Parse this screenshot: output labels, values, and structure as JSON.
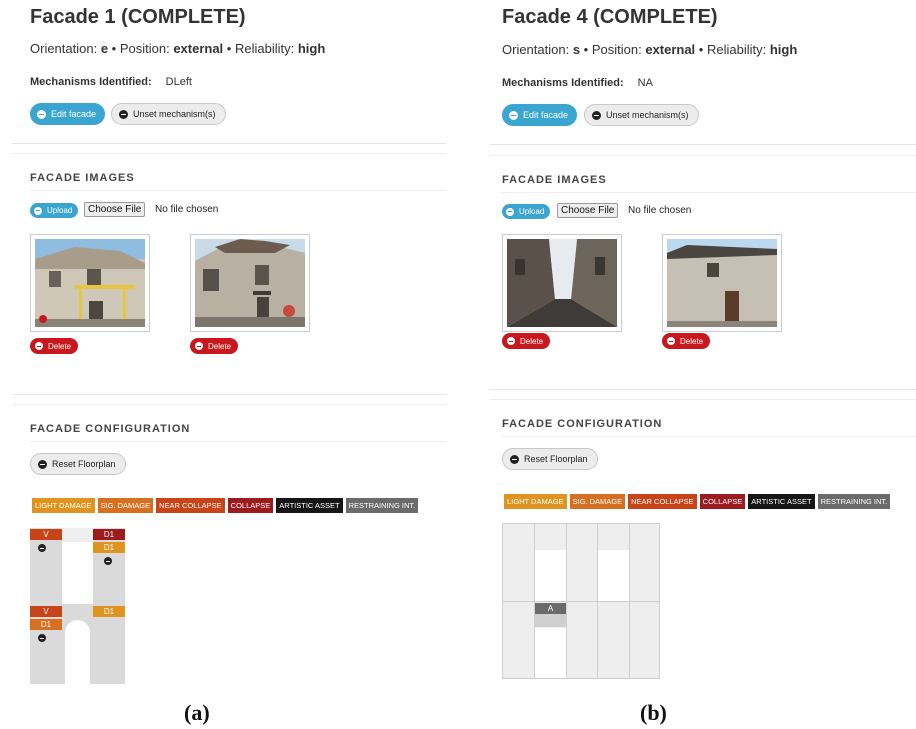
{
  "colors": {
    "light_damage": "#e09420",
    "sig_damage": "#d67020",
    "near_collapse": "#c84418",
    "collapse": "#9b1b1e",
    "artistic_asset": "#161616",
    "restraining_int": "#6b6b6b",
    "accent_blue": "#3aa6d0",
    "delete_red": "#c8171d",
    "grid_grey": "#dadada"
  },
  "panel_a": {
    "title": "Facade 1 (COMPLETE)",
    "orientation_label": "Orientation: ",
    "orientation_value": "e",
    "position_label": " • Position: ",
    "position_value": "external",
    "reliability_label": " • Reliability: ",
    "reliability_value": "high",
    "mechanisms_label": "Mechanisms Identified:",
    "mechanisms_value": "DLeft",
    "edit_button": "Edit facade",
    "unset_button": "Unset mechanism(s)",
    "images_heading": "FACADE IMAGES",
    "upload_button": "Upload",
    "choose_file": "Choose File",
    "no_file": "No file chosen",
    "delete_button": "Delete",
    "config_heading": "FACADE CONFIGURATION",
    "reset_button": "Reset Floorplan",
    "tags": {
      "v1": "V",
      "d1a": "D1",
      "d1b": "D1",
      "v2": "V",
      "d1c": "D1",
      "d1d": "D1"
    },
    "image_icons": [
      "photo-building-damaged-icon",
      "photo-building-collapsed-roof-icon"
    ]
  },
  "panel_b": {
    "title": "Facade 4 (COMPLETE)",
    "orientation_label": "Orientation: ",
    "orientation_value": "s",
    "position_label": " • Position: ",
    "position_value": "external",
    "reliability_label": " • Reliability: ",
    "reliability_value": "high",
    "mechanisms_label": "Mechanisms Identified:",
    "mechanisms_value": "NA",
    "edit_button": "Edit facade",
    "unset_button": "Unset mechanism(s)",
    "images_heading": "FACADE IMAGES",
    "upload_button": "Upload",
    "choose_file": "Choose File",
    "no_file": "No file chosen",
    "delete_button": "Delete",
    "config_heading": "FACADE CONFIGURATION",
    "reset_button": "Reset Floorplan",
    "tags": {
      "a1": "A"
    },
    "image_icons": [
      "photo-narrow-street-icon",
      "photo-building-facade-icon"
    ]
  },
  "legend": [
    {
      "label": "LIGHT DAMAGE",
      "color": "#e09420"
    },
    {
      "label": "SIG. DAMAGE",
      "color": "#d67020"
    },
    {
      "label": "NEAR COLLAPSE",
      "color": "#c84418"
    },
    {
      "label": "COLLAPSE",
      "color": "#9b1b1e"
    },
    {
      "label": "ARTISTIC ASSET",
      "color": "#161616"
    },
    {
      "label": "RESTRAINING INT.",
      "color": "#6b6b6b"
    }
  ],
  "captions": {
    "a": "(a)",
    "b": "(b)"
  }
}
